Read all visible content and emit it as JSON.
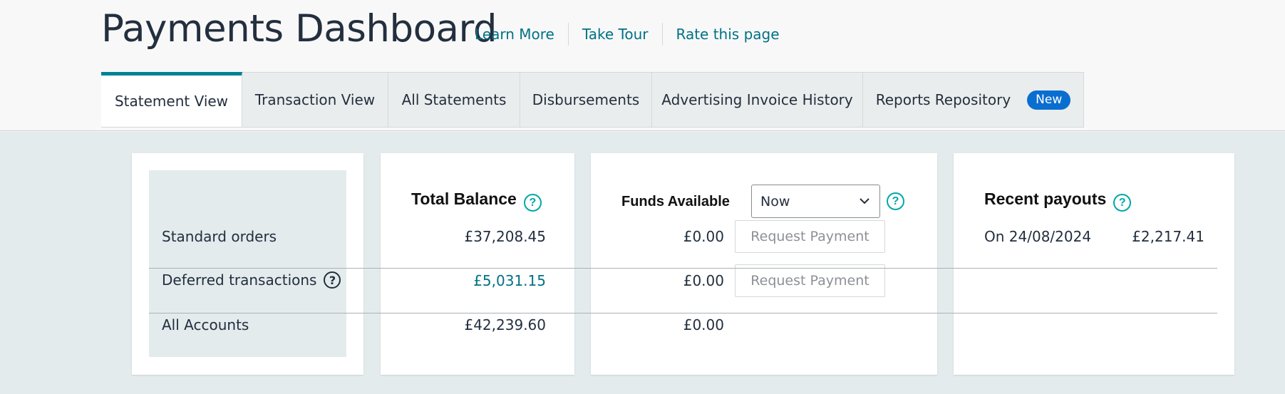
{
  "header": {
    "title": "Payments Dashboard",
    "links": [
      "Learn More",
      "Take Tour",
      "Rate this page"
    ]
  },
  "tabs": [
    {
      "label": "Statement View",
      "active": true
    },
    {
      "label": "Transaction View",
      "active": false
    },
    {
      "label": "All Statements",
      "active": false
    },
    {
      "label": "Disbursements",
      "active": false
    },
    {
      "label": "Advertising Invoice History",
      "active": false
    },
    {
      "label": "Reports Repository",
      "active": false,
      "badge": "New"
    }
  ],
  "rows": {
    "standard": "Standard orders",
    "deferred": "Deferred transactions",
    "all": "All Accounts"
  },
  "total_balance": {
    "title": "Total Balance",
    "standard": "£37,208.45",
    "deferred": "£5,031.15",
    "all": "£42,239.60"
  },
  "funds_available": {
    "title": "Funds Available",
    "selected": "Now",
    "standard": "£0.00",
    "deferred": "£0.00",
    "all": "£0.00",
    "button_label": "Request Payment"
  },
  "recent_payouts": {
    "title": "Recent payouts",
    "items": [
      {
        "date": "On 24/08/2024",
        "amount": "£2,217.41"
      }
    ]
  },
  "icons": {
    "help": "help-circle-icon",
    "chevron": "chevron-down-icon"
  },
  "colors": {
    "accent": "#008296",
    "link": "#007185",
    "badge": "#0a6ed1",
    "help_icon": "#00a8a8"
  }
}
